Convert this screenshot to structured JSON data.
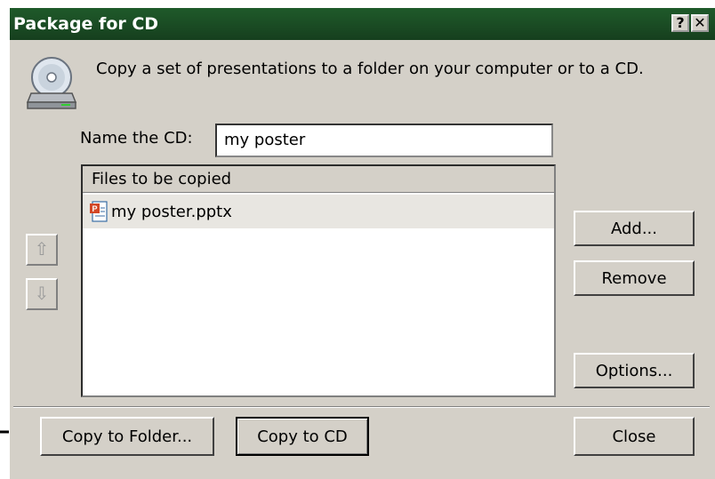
{
  "dialog": {
    "title": "Package for CD",
    "help_label": "?",
    "close_label": "✕",
    "intro_text": "Copy a set of presentations to a folder on your computer or to a CD.",
    "name_label": "Name the CD:",
    "name_value": "my poster",
    "file_list": {
      "header": "Files to be copied",
      "files": [
        "my poster.pptx"
      ]
    },
    "move_up_icon": "arrow-up",
    "move_down_icon": "arrow-down",
    "buttons": {
      "add": "Add...",
      "remove": "Remove",
      "options": "Options...",
      "copy_to_folder": "Copy to Folder...",
      "copy_to_cd": "Copy to CD",
      "close": "Close"
    }
  },
  "colors": {
    "titlebar": "#1f5a2a",
    "dialog_bg": "#d4d0c8"
  }
}
